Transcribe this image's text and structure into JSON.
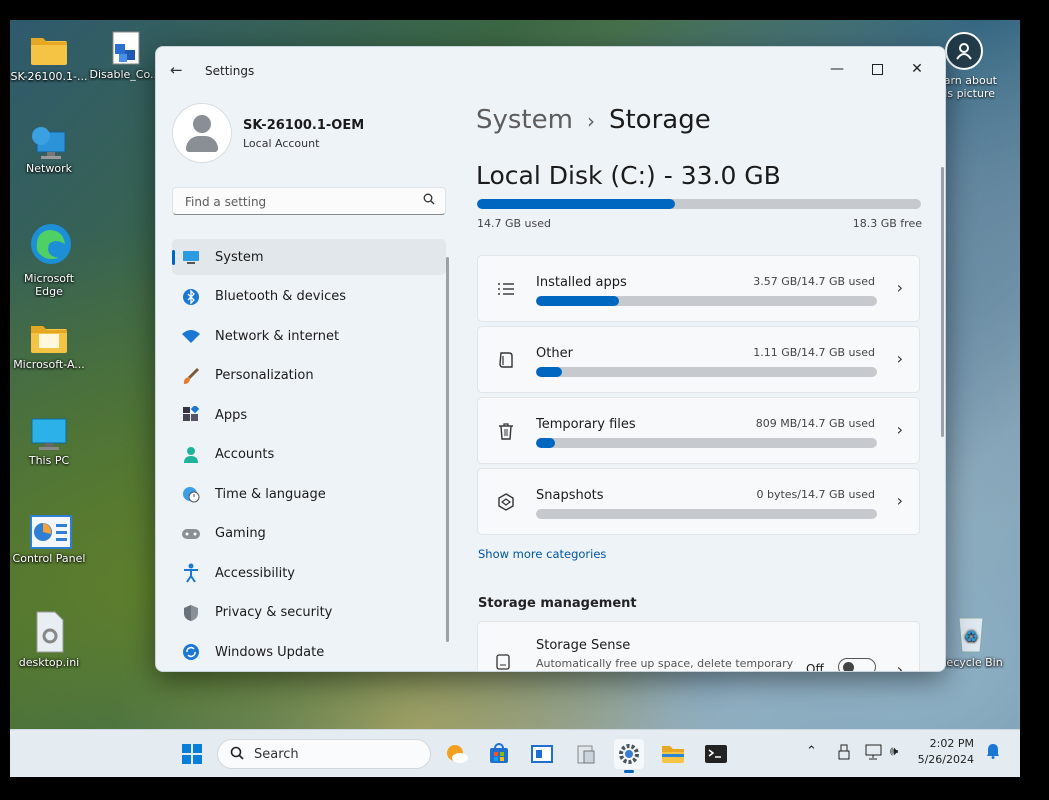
{
  "desktop": {
    "icons": [
      {
        "label": "SK-26100.1-..."
      },
      {
        "label": "Disable_Co..."
      },
      {
        "label": "Network"
      },
      {
        "label": "Microsoft Edge"
      },
      {
        "label": "Microsoft-A..."
      },
      {
        "label": "This PC"
      },
      {
        "label": "Control Panel"
      },
      {
        "label": "desktop.ini"
      },
      {
        "label": "Recycle Bin"
      }
    ],
    "spotlight_label": "Learn about this picture"
  },
  "window": {
    "title": "Settings",
    "profile": {
      "name": "SK-26100.1-OEM",
      "type": "Local Account"
    },
    "search": {
      "placeholder": "Find a setting"
    },
    "nav": [
      {
        "label": "System",
        "icon": "monitor-icon",
        "active": true
      },
      {
        "label": "Bluetooth & devices",
        "icon": "bluetooth-icon"
      },
      {
        "label": "Network & internet",
        "icon": "wifi-icon"
      },
      {
        "label": "Personalization",
        "icon": "brush-icon"
      },
      {
        "label": "Apps",
        "icon": "apps-icon"
      },
      {
        "label": "Accounts",
        "icon": "person-icon"
      },
      {
        "label": "Time & language",
        "icon": "globe-clock-icon"
      },
      {
        "label": "Gaming",
        "icon": "gamepad-icon"
      },
      {
        "label": "Accessibility",
        "icon": "accessibility-icon"
      },
      {
        "label": "Privacy & security",
        "icon": "shield-icon"
      },
      {
        "label": "Windows Update",
        "icon": "update-icon"
      }
    ]
  },
  "content": {
    "breadcrumb": {
      "parent": "System",
      "separator": "›",
      "current": "Storage"
    },
    "disk": {
      "title": "Local Disk (C:) - 33.0 GB",
      "used_label": "14.7 GB used",
      "free_label": "18.3 GB free",
      "used_fraction": 0.445
    },
    "categories": [
      {
        "title": "Installed apps",
        "value": "3.57 GB/14.7 GB used",
        "fraction": 0.243,
        "icon": "list-icon"
      },
      {
        "title": "Other",
        "value": "1.11 GB/14.7 GB used",
        "fraction": 0.0755,
        "icon": "document-icon"
      },
      {
        "title": "Temporary files",
        "value": "809 MB/14.7 GB used",
        "fraction": 0.055,
        "icon": "trash-icon"
      },
      {
        "title": "Snapshots",
        "value": "0 bytes/14.7 GB used",
        "fraction": 0.0,
        "icon": "snapshot-icon"
      }
    ],
    "show_more": "Show more categories",
    "management_heading": "Storage management",
    "storage_sense": {
      "title": "Storage Sense",
      "description": "Automatically free up space, delete temporary",
      "toggle_label": "Off"
    }
  },
  "taskbar": {
    "search_placeholder": "Search",
    "time": "2:02 PM",
    "date": "5/26/2024"
  },
  "colors": {
    "accent": "#0067c0",
    "link": "#0055a0"
  }
}
